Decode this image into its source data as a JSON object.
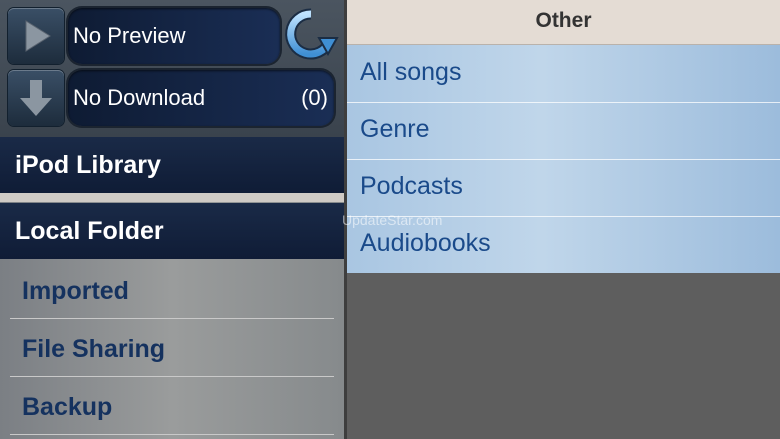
{
  "player": {
    "preview_label": "No Preview",
    "download_label": "No Download",
    "download_count": "(0)"
  },
  "sidebar": {
    "ipod_library": "iPod Library",
    "local_folder": "Local Folder",
    "items": [
      {
        "label": "Imported"
      },
      {
        "label": "File Sharing"
      },
      {
        "label": "Backup"
      }
    ]
  },
  "main": {
    "header_title": "Other",
    "items": [
      {
        "label": "All songs"
      },
      {
        "label": "Genre"
      },
      {
        "label": "Podcasts"
      },
      {
        "label": "Audiobooks"
      }
    ]
  },
  "watermark": "UpdateStar.com",
  "icons": {
    "play": "play-icon",
    "download": "download-arrow-icon",
    "refresh": "refresh-icon"
  },
  "colors": {
    "header_dark": "#0f1c36",
    "list_blue": "#a9c6e2",
    "list_text": "#1a4a8a",
    "folder_text": "#15325f"
  }
}
